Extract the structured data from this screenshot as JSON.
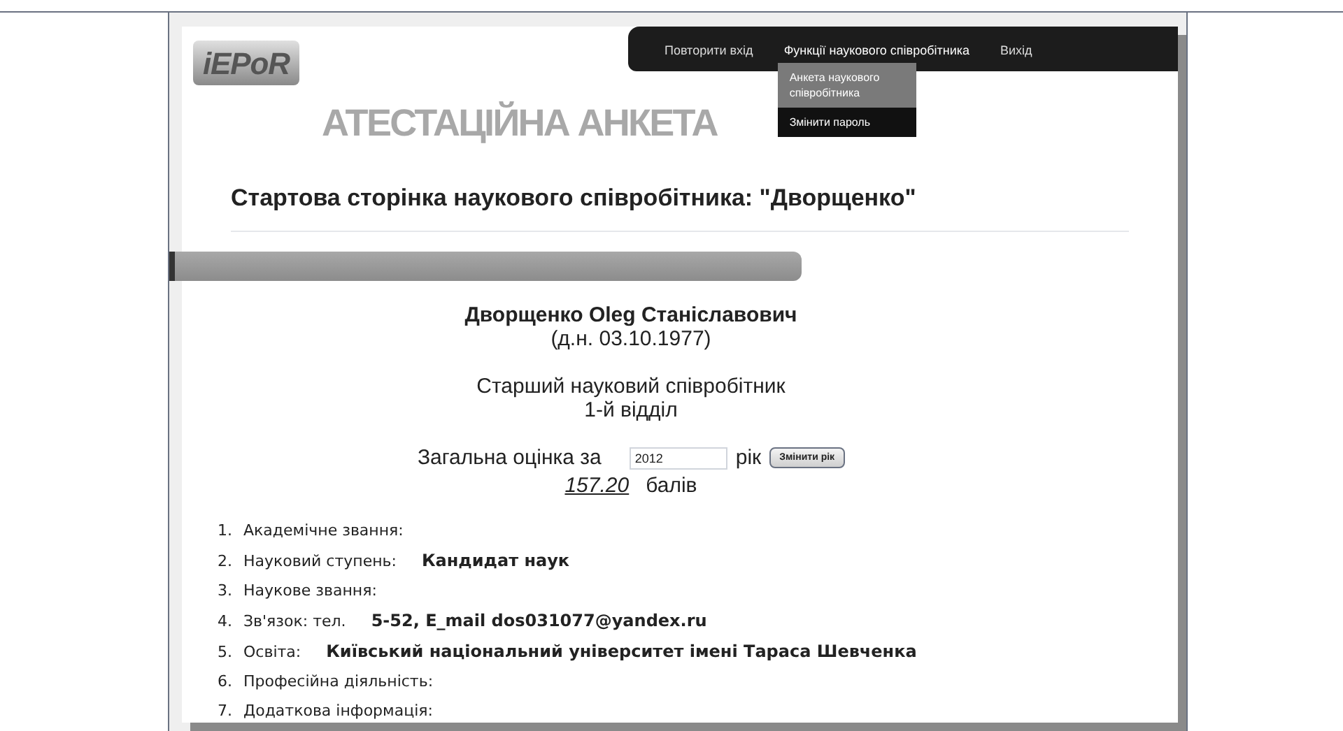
{
  "logo": {
    "text": "iEPoR"
  },
  "banner": {
    "title": "АТЕСТАЦІЙНА АНКЕТА"
  },
  "nav": {
    "items": [
      {
        "label": "Повторити вхід",
        "expanded": false
      },
      {
        "label": "Функції наукового співробітника",
        "expanded": true
      },
      {
        "label": "Вихід",
        "expanded": false
      }
    ],
    "dropdown": [
      {
        "label": "Анкета наукового співробітника",
        "selected": true
      },
      {
        "label": "Змінити пароль",
        "selected": false
      }
    ]
  },
  "page_title": "Стартова сторінка наукового співробітника: \"Дворщенко\"",
  "person": {
    "name": "Дворщенко Oleg Станіславович",
    "birth": "(д.н. 03.10.1977)",
    "position": "Старший науковий співробітник",
    "department": "1-й відділ"
  },
  "score": {
    "label": "Загальна оцінка за",
    "year": "2012",
    "year_unit": "рік",
    "button": "Змінити рік",
    "value": "157.20",
    "unit": "балів"
  },
  "fields": [
    {
      "number": "1.",
      "label": "Академічне звання:"
    },
    {
      "number": "2.",
      "label": "Науковий ступень:",
      "value": "Кандидат наук"
    },
    {
      "number": "3.",
      "label": "Наукове звання:"
    },
    {
      "number": "4.",
      "label": "Зв'язок: тел.",
      "value": "5-52, E_mail  dos031077@yandex.ru"
    },
    {
      "number": "5.",
      "label": "Освіта:",
      "value": "Київський національний університет імені Тараса Шевченка"
    },
    {
      "number": "6.",
      "label": "Професійна діяльність:"
    },
    {
      "number": "7.",
      "label": "Додаткова інформація:"
    }
  ]
}
